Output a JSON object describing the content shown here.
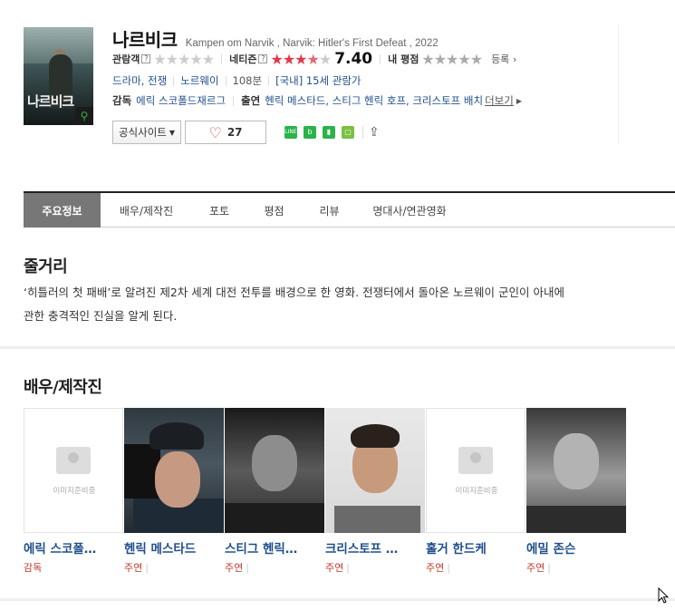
{
  "movie": {
    "title_ko": "나르비크",
    "title_en": "Kampen om Narvik , Narvik: Hitler's First Defeat , 2022",
    "poster_title": "나르비크",
    "audience_label": "관람객",
    "netizen_label": "네티즌",
    "netizen_stars": 3.7,
    "netizen_score": "7.40",
    "my_score_label": "내 평점",
    "register_label": "등록",
    "genres": "드라마, 전쟁",
    "country": "노르웨이",
    "runtime": "108분",
    "rating": "[국내] 15세 관람가",
    "director_label": "감독",
    "director": "에릭 스코폴드재르그",
    "cast_label": "출연",
    "cast": "헨릭 메스타드, 스티그 헨릭 호프, 크리스토프 배치",
    "more_label": "더보기",
    "site_button": "공식사이트",
    "like_count": "27"
  },
  "tabs": [
    {
      "label": "주요정보",
      "active": true
    },
    {
      "label": "배우/제작진",
      "active": false
    },
    {
      "label": "포토",
      "active": false
    },
    {
      "label": "평점",
      "active": false
    },
    {
      "label": "리뷰",
      "active": false
    },
    {
      "label": "명대사/연관영화",
      "active": false
    }
  ],
  "synopsis": {
    "heading": "줄거리",
    "line1": "‘히틀러의 첫 패배’로 알려진 제2차 세계 대전 전투를 배경으로 한 영화. 전쟁터에서 돌아온 노르웨이 군인이 아내에",
    "line2": "관한 충격적인 진실을 알게 된다."
  },
  "castSection": {
    "heading": "배우/제작진",
    "noimage_text": "이미지준비중",
    "people": [
      {
        "name": "에릭 스코폴…",
        "role": "감독"
      },
      {
        "name": "헨릭 메스타드",
        "role": "주연"
      },
      {
        "name": "스티그 헨릭…",
        "role": "주연"
      },
      {
        "name": "크리스토프 …",
        "role": "주연"
      },
      {
        "name": "홀거 한드케",
        "role": "주연"
      },
      {
        "name": "에밀 존슨",
        "role": "주연"
      }
    ]
  },
  "icons": [
    "question-icon",
    "star-icon",
    "chevron-right-icon",
    "caret-down-icon",
    "heart-icon",
    "line-share-icon",
    "band-share-icon",
    "bookmark-icon",
    "memo-icon",
    "share-icon",
    "search-icon",
    "cursor-icon"
  ],
  "colors": {
    "accent_red": "#e0384a",
    "link_blue": "#1f4e8c",
    "tab_active": "#777777"
  }
}
